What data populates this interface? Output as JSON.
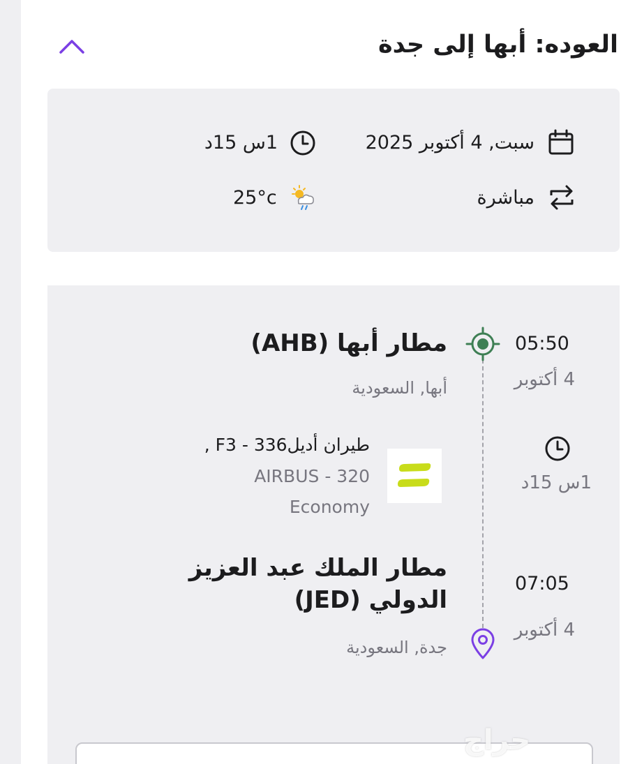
{
  "header": {
    "title": "العوده: أبها إلى جدة",
    "collapse_icon": "chevron-up-icon",
    "accent_color": "#7b3fe4"
  },
  "summary": {
    "date": "سبت, 4 أكتوبر 2025",
    "duration": "1س 15د",
    "stops": "مباشرة",
    "temperature": "25°c"
  },
  "departure": {
    "time": "05:50",
    "date": "4 أكتوبر",
    "airport": "مطار أبها (AHB)",
    "city": "أبها, السعودية",
    "marker_color": "#3e7f54"
  },
  "segment": {
    "duration": "1س 15د",
    "airline": "طيران أديل336 - F3 ,",
    "aircraft": "AIRBUS - 320",
    "cabin": "Economy",
    "logo_color": "#c8dc1a"
  },
  "arrival": {
    "time": "07:05",
    "date": "4 أكتوبر",
    "airport": "مطار الملك عبد العزيز الدولي (JED)",
    "city": "جدة, السعودية",
    "marker_color": "#7b3fe4"
  },
  "watermark": "حراج"
}
